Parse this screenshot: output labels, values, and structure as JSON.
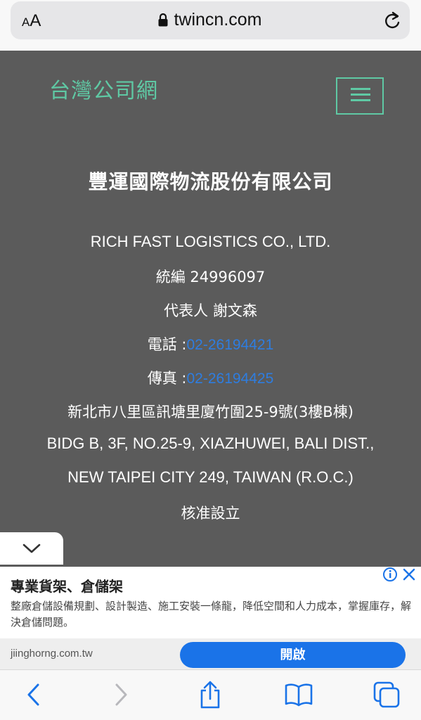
{
  "browser": {
    "aa_small": "A",
    "aa_big": "A",
    "url": "twincn.com",
    "icons": [
      "lock-icon",
      "reload-icon"
    ]
  },
  "site": {
    "logo": "台灣公司網",
    "menu_icon": "hamburger-icon"
  },
  "company": {
    "name": "豐運國際物流股份有限公司",
    "english_name": "RICH FAST LOGISTICS CO., LTD.",
    "tax_id": "統編 24996097",
    "representative": "代表人 謝文森",
    "phone_label": "電話 :",
    "phone": "02-26194421",
    "fax_label": "傳真 :",
    "fax": "02-26194425",
    "address_zh": "新北市八里區訊塘里廈竹圍25-9號(3樓B棟)",
    "address_en_1": "BIDG B, 3F, NO.25-9, XIAZHUWEI, BALI DIST.,",
    "address_en_2": "NEW TAIPEI CITY 249, TAIWAN (R.O.C.)",
    "status": "核准設立"
  },
  "ad": {
    "title": "專業貨架、倉儲架",
    "body": "整廠倉儲設備規劃、設計製造、施工安裝一條龍，降低空間和人力成本，掌握庫存，解決倉儲問題。",
    "domain": "jiinghorng.com.tw",
    "button": "開啟",
    "colors": {
      "button": "#1a73e8",
      "info": "#1a73e8"
    }
  },
  "toolbar": {
    "items": [
      "back-icon",
      "forward-icon",
      "share-icon",
      "bookmarks-icon",
      "tabs-icon"
    ]
  },
  "colors": {
    "page_bg": "#5b5b5b",
    "accent": "#5fc9a4",
    "link": "#2e7de0",
    "system_blue": "#1a73e8"
  }
}
